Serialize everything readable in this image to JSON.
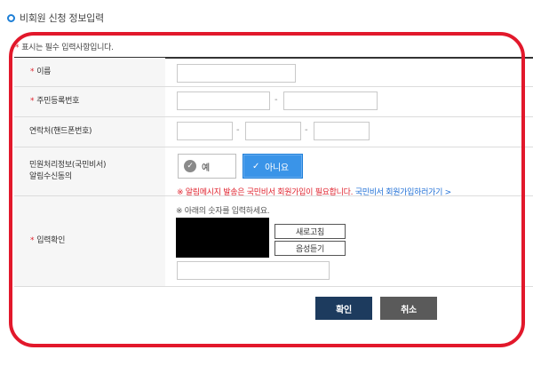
{
  "section": {
    "title": "비회원 신청 정보입력"
  },
  "required_note": {
    "star": "*",
    "text": "표시는 필수 입력사항입니다."
  },
  "rows": {
    "name": {
      "star": "*",
      "label": "이름",
      "value": ""
    },
    "resident_number": {
      "star": "*",
      "label": "주민등록번호",
      "separator": "-"
    },
    "phone": {
      "label": "연락처(핸드폰번호)",
      "separator": "-"
    },
    "consent": {
      "label_line1": "민원처리정보(국민비서)",
      "label_line2": "알림수신동의",
      "yes_label": "예",
      "no_label": "아니요",
      "selected": "아니요",
      "warning": "※ 알림메시지 발송은 국민비서 회원가입이 필요합니다.",
      "signup_link": "국민비서 회원가입하러가기 >"
    },
    "captcha": {
      "star": "*",
      "label": "입력확인",
      "hint": "※ 아래의 숫자를 입력하세요.",
      "refresh_label": "새로고침",
      "voice_label": "음성듣기"
    }
  },
  "actions": {
    "confirm_label": "확인",
    "cancel_label": "취소"
  },
  "colors": {
    "accent": "#1e7fd6",
    "required": "#e0242f",
    "highlight_outline": "#e2182b",
    "confirm_bg": "#1d3b5e",
    "cancel_bg": "#5a5a5a"
  },
  "icons": {
    "section_bullet": "circle-bullet-icon",
    "checked": "check-icon"
  }
}
